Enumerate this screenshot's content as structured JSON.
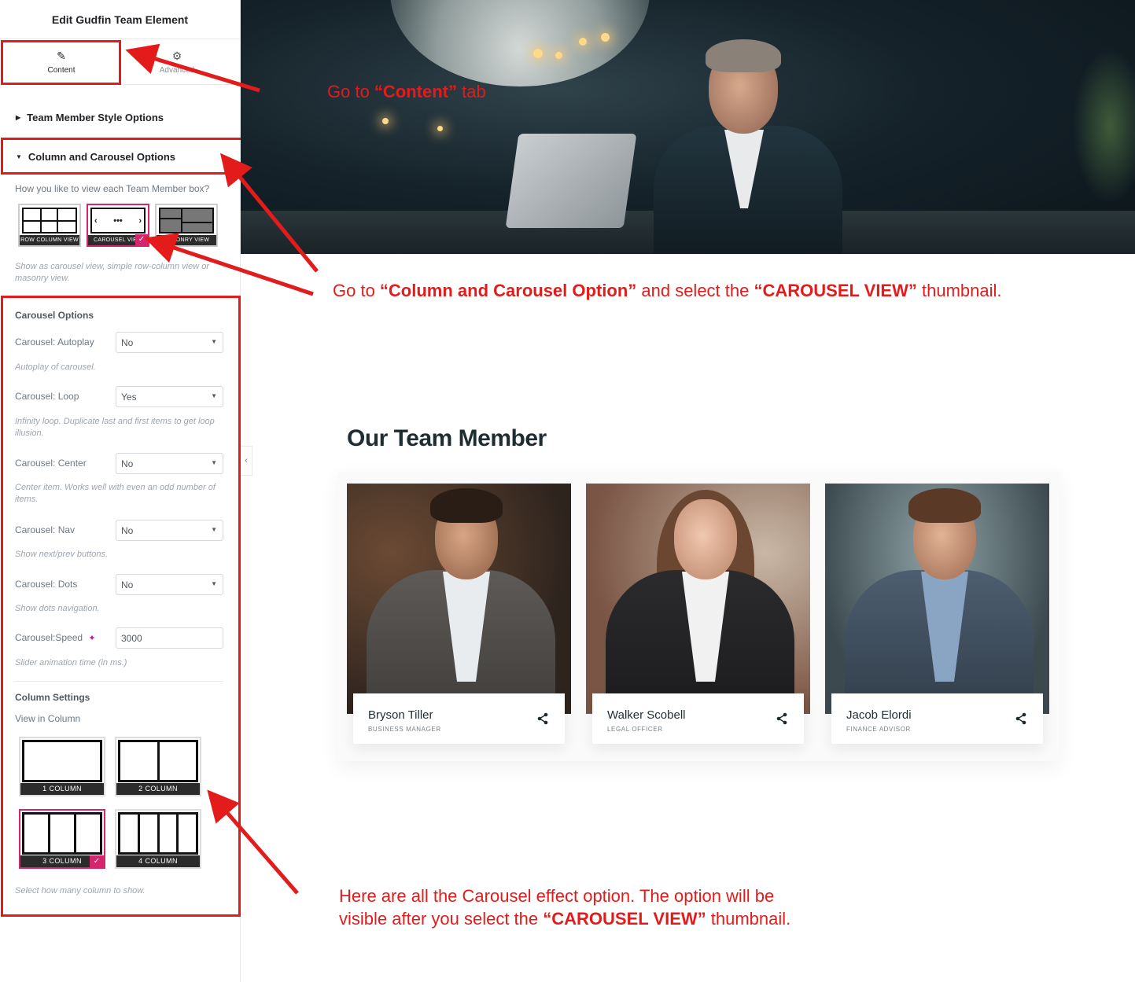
{
  "panel": {
    "title": "Edit Gudfin Team Element",
    "tabs": [
      {
        "label": "Content",
        "icon": "pencil-icon"
      },
      {
        "label": "Advanced",
        "icon": "gear-icon"
      }
    ],
    "sections": {
      "style": "Team Member Style Options",
      "column_carousel": "Column and Carousel Options"
    },
    "view_question": "How you like to view each Team Member box?",
    "views": [
      {
        "caption": "ROW COLUMN VIEW",
        "selected": false
      },
      {
        "caption": "CAROUSEL VIEW",
        "selected": true
      },
      {
        "caption": "MASONRY VIEW",
        "selected": false
      }
    ],
    "view_help": "Show as carousel view, simple row-column view or masonry view.",
    "carousel_options_title": "Carousel Options",
    "autoplay": {
      "label": "Carousel: Autoplay",
      "value": "No",
      "help": "Autoplay of carousel."
    },
    "loop": {
      "label": "Carousel: Loop",
      "value": "Yes",
      "help": "Infinity loop. Duplicate last and first items to get loop illusion."
    },
    "center": {
      "label": "Carousel: Center",
      "value": "No",
      "help": "Center item. Works well with even an odd number of items."
    },
    "nav": {
      "label": "Carousel: Nav",
      "value": "No",
      "help": "Show next/prev buttons."
    },
    "dots": {
      "label": "Carousel: Dots",
      "value": "No",
      "help": "Show dots navigation."
    },
    "speed": {
      "label": "Carousel:Speed",
      "value": "3000",
      "help": "Slider animation time (in ms.)"
    },
    "column_settings_title": "Column Settings",
    "view_in_column": "View in Column",
    "columns": [
      {
        "caption": "1 COLUMN",
        "selected": false
      },
      {
        "caption": "2 COLUMN",
        "selected": false
      },
      {
        "caption": "3 COLUMN",
        "selected": true
      },
      {
        "caption": "4 COLUMN",
        "selected": false
      }
    ],
    "columns_help": "Select how many column to show."
  },
  "annotations": {
    "content_tab": {
      "pre": "Go  to ",
      "bold": "“Content”",
      "post": " tab"
    },
    "carousel_option": {
      "pre": "Go to ",
      "bold1": "“Column and Carousel Option”",
      "mid": " and select the ",
      "bold2": "“CAROUSEL VIEW”",
      "post": " thumbnail."
    },
    "all_options": {
      "line1": "Here are all the Carousel effect option. The option will be",
      "line2_pre": "visible after you select the ",
      "line2_bold": "“CAROUSEL VIEW”",
      "line2_post": " thumbnail."
    },
    "color": "#e31b1b"
  },
  "team": {
    "title": "Our Team Member",
    "members": [
      {
        "name": "Bryson Tiller",
        "role": "BUSINESS MANAGER"
      },
      {
        "name": "Walker Scobell",
        "role": "LEGAL OFFICER"
      },
      {
        "name": "Jacob Elordi",
        "role": "FINANCE ADVISOR"
      }
    ]
  },
  "colors": {
    "accent": "#d5256b",
    "annotation": "#e31b1b",
    "heading": "#1f2d33"
  }
}
